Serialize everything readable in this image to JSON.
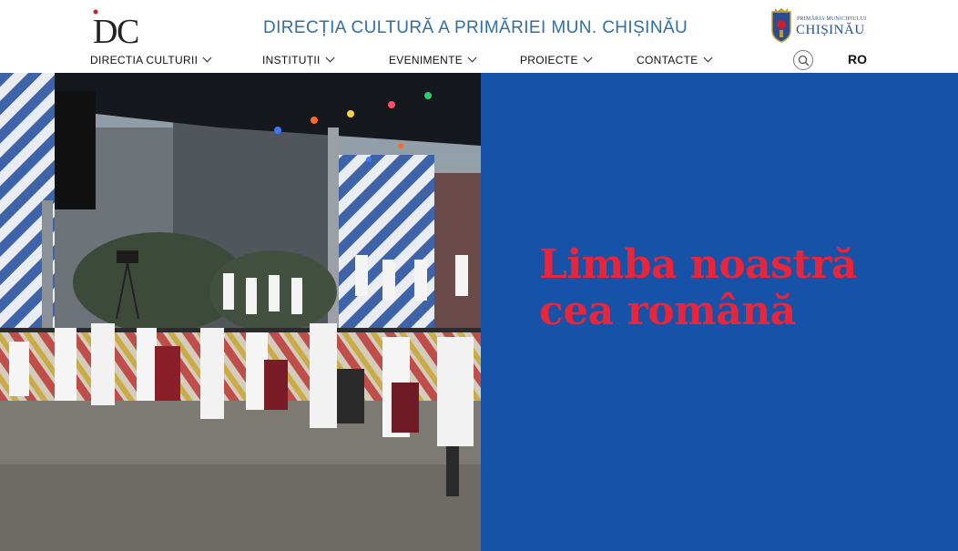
{
  "header": {
    "logo_text": "DC",
    "site_title": "DIRECȚIA CULTURĂ A PRIMĂRIEI MUN. CHIȘINĂU",
    "partner_logo": {
      "small_text": "PRIMĂRIA MUNICIPIULUI",
      "big_text": "CHIȘINĂU"
    }
  },
  "nav": {
    "items": [
      {
        "label": "DIRECTIA CULTURII",
        "icon": "chevron-down-icon"
      },
      {
        "label": "INSTITUȚII",
        "icon": "chevron-down-icon"
      },
      {
        "label": "EVENIMENTE",
        "icon": "chevron-down-icon"
      },
      {
        "label": "PROIECTE",
        "icon": "chevron-down-icon"
      },
      {
        "label": "CONTACTE",
        "icon": "chevron-down-icon"
      }
    ],
    "search_icon": "search-icon",
    "language": "RO"
  },
  "hero": {
    "title_line1": "Limba noastră",
    "title_line2": "cea română",
    "panel_color": "#1552a8",
    "title_color": "#e8253b"
  }
}
